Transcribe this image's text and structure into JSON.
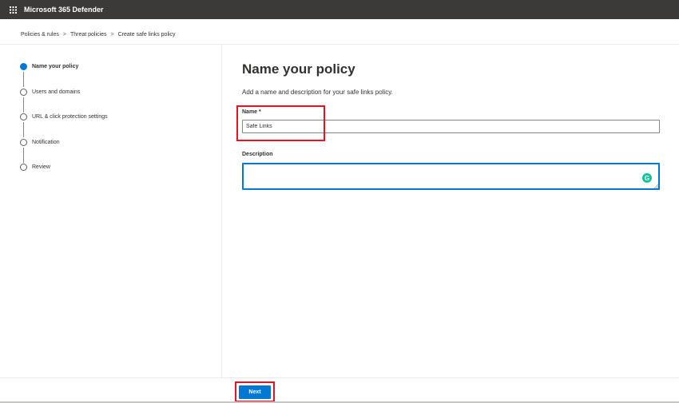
{
  "app": {
    "title": "Microsoft 365 Defender",
    "launcher_icon": "app-launcher-waffle-icon"
  },
  "breadcrumb": [
    "Policies & rules",
    "Threat policies",
    "Create safe links policy"
  ],
  "breadcrumb_separator": ">",
  "wizard": {
    "steps": [
      {
        "label": "Name your policy",
        "active": true
      },
      {
        "label": "Users and domains",
        "active": false
      },
      {
        "label": "URL & click protection settings",
        "active": false
      },
      {
        "label": "Notification",
        "active": false
      },
      {
        "label": "Review",
        "active": false
      }
    ]
  },
  "main": {
    "title": "Name your policy",
    "description": "Add a name and description for your safe links policy.",
    "name_field": {
      "label": "Name *",
      "value": "Safe Links"
    },
    "description_field": {
      "label": "Description",
      "value": ""
    },
    "grammarly_badge": "G"
  },
  "footer": {
    "next_label": "Next"
  },
  "colors": {
    "accent": "#0078d4",
    "topbar": "#3b3a39",
    "highlight": "#e81123"
  }
}
